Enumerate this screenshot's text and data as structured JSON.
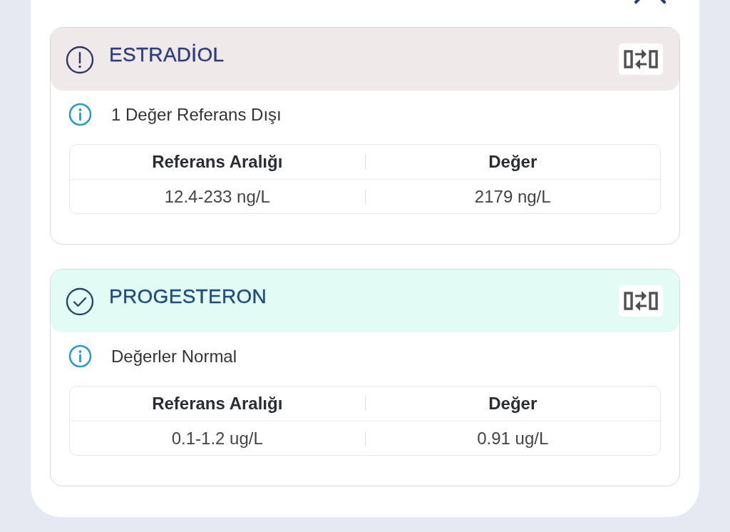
{
  "results": [
    {
      "kind": "warning",
      "name": "ESTRADİOL",
      "summary": "1 Değer Referans Dışı",
      "columns": [
        "Referans Aralığı",
        "Değer"
      ],
      "values": [
        "12.4-233 ng/L",
        "2179 ng/L"
      ]
    },
    {
      "kind": "normal",
      "name": "PROGESTERON",
      "summary": "Değerler Normal",
      "columns": [
        "Referans Aralığı",
        "Değer"
      ],
      "values": [
        "0.1-1.2 ug/L",
        "0.91 ug/L"
      ]
    }
  ]
}
